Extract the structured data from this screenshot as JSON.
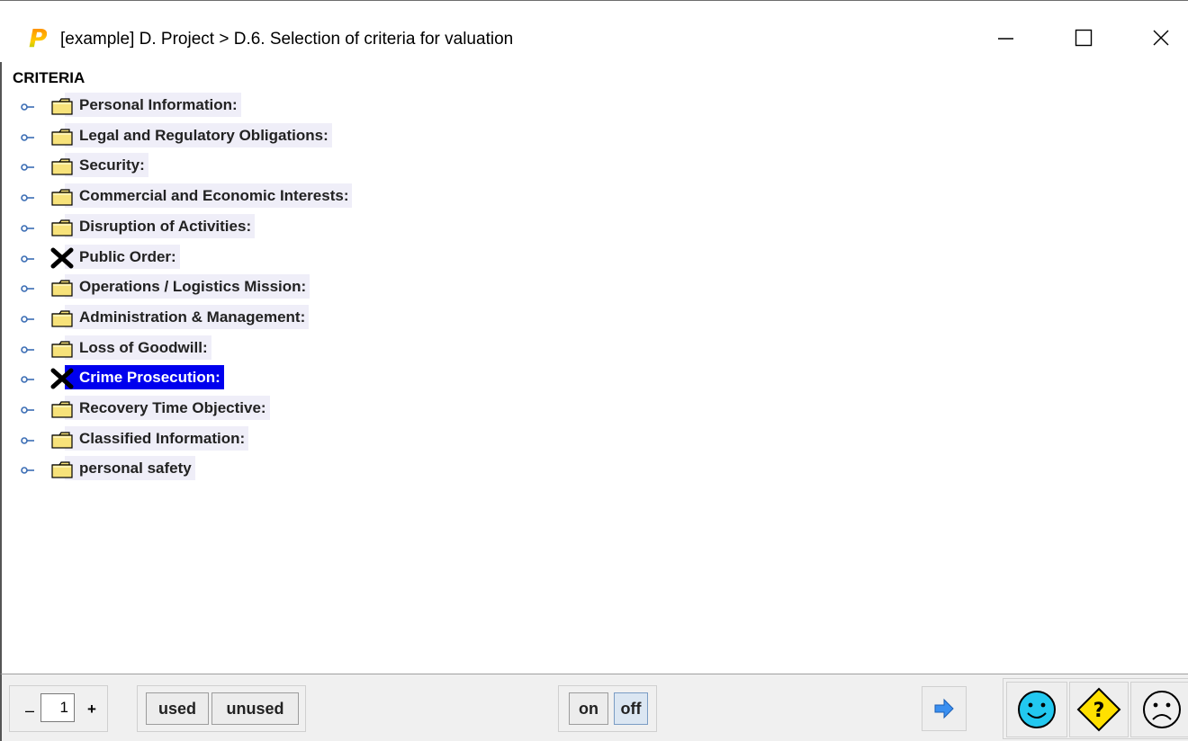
{
  "window": {
    "title": "[example] D. Project > D.6. Selection of criteria for valuation",
    "logo_letter": "P",
    "controls": [
      "minimize-icon",
      "maximize-icon",
      "close-icon"
    ]
  },
  "tree": {
    "root_label": "CRITERIA",
    "items": [
      {
        "label": "Personal Information:",
        "icon": "folder-icon",
        "selected": false
      },
      {
        "label": "Legal and Regulatory Obligations:",
        "icon": "folder-icon",
        "selected": false
      },
      {
        "label": "Security:",
        "icon": "folder-icon",
        "selected": false
      },
      {
        "label": "Commercial and Economic Interests:",
        "icon": "folder-icon",
        "selected": false
      },
      {
        "label": "Disruption of Activities:",
        "icon": "folder-icon",
        "selected": false
      },
      {
        "label": "Public Order:",
        "icon": "x-mark-icon",
        "selected": false
      },
      {
        "label": "Operations / Logistics Mission:",
        "icon": "folder-icon",
        "selected": false
      },
      {
        "label": "Administration & Management:",
        "icon": "folder-icon",
        "selected": false
      },
      {
        "label": "Loss of Goodwill:",
        "icon": "folder-icon",
        "selected": false
      },
      {
        "label": "Crime Prosecution:",
        "icon": "x-mark-icon",
        "selected": true
      },
      {
        "label": "Recovery Time Objective:",
        "icon": "folder-icon",
        "selected": false
      },
      {
        "label": "Classified Information:",
        "icon": "folder-icon",
        "selected": false
      },
      {
        "label": "personal safety",
        "icon": "folder-icon",
        "selected": false
      }
    ]
  },
  "statusbar": {
    "stepper": {
      "minus": "–",
      "value": "1",
      "plus": "+"
    },
    "used_label": "used",
    "unused_label": "unused",
    "on_label": "on",
    "off_label": "off",
    "icons": [
      "arrow-right-icon",
      "smiley-happy-icon",
      "help-question-icon",
      "smiley-sad-icon"
    ]
  },
  "colors": {
    "selection": "#0000ee",
    "row_background": "#efeef8",
    "folder": "#f7e27a",
    "smiley": "#22c8f0",
    "help_sign": "#ffe000"
  }
}
